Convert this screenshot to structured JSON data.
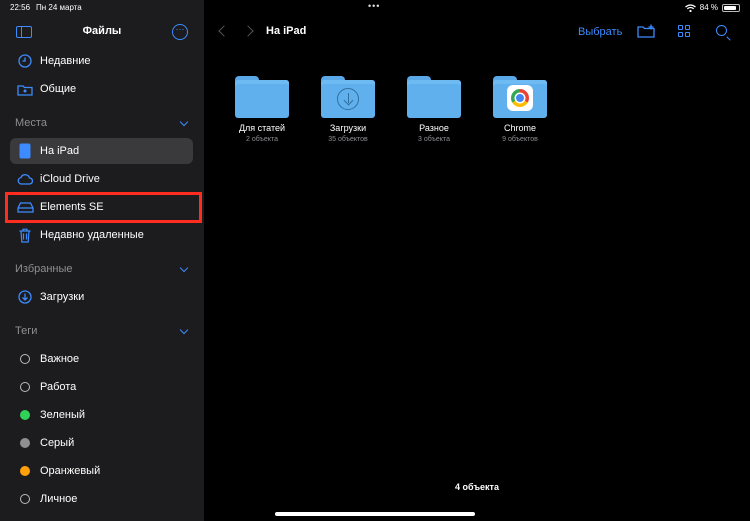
{
  "status": {
    "time": "22:56",
    "date": "Пн 24 марта",
    "battery": "84 %",
    "battery_level": 0.84
  },
  "sidebar": {
    "title": "Файлы",
    "top_items": [
      {
        "label": "Недавние",
        "icon": "clock-icon"
      },
      {
        "label": "Общие",
        "icon": "shared-folder-icon"
      }
    ],
    "sections": {
      "places": {
        "title": "Места",
        "items": [
          {
            "label": "На iPad",
            "icon": "ipad-icon",
            "selected": true
          },
          {
            "label": "iCloud Drive",
            "icon": "cloud-icon"
          },
          {
            "label": "Elements SE",
            "icon": "drive-icon"
          },
          {
            "label": "Недавно удаленные",
            "icon": "trash-icon"
          }
        ]
      },
      "favorites": {
        "title": "Избранные",
        "items": [
          {
            "label": "Загрузки",
            "icon": "download-circle-icon"
          }
        ]
      },
      "tags": {
        "title": "Теги",
        "items": [
          {
            "label": "Важное",
            "color": ""
          },
          {
            "label": "Работа",
            "color": ""
          },
          {
            "label": "Зеленый",
            "color": "#30d158"
          },
          {
            "label": "Серый",
            "color": "#8e8e93"
          },
          {
            "label": "Оранжевый",
            "color": "#ff9f0a"
          },
          {
            "label": "Личное",
            "color": ""
          }
        ]
      }
    }
  },
  "main": {
    "title": "На iPad",
    "select_label": "Выбрать",
    "folders": [
      {
        "name": "Для статей",
        "count": "2 объекта",
        "badge": ""
      },
      {
        "name": "Загрузки",
        "count": "35 объектов",
        "badge": "download"
      },
      {
        "name": "Разное",
        "count": "3 объекта",
        "badge": ""
      },
      {
        "name": "Chrome",
        "count": "9 объектов",
        "badge": "chrome"
      }
    ],
    "footer": "4 объекта"
  },
  "colors": {
    "accent": "#3d8bff",
    "annotation": "#ff2d20",
    "folder": "#61b0ee"
  }
}
